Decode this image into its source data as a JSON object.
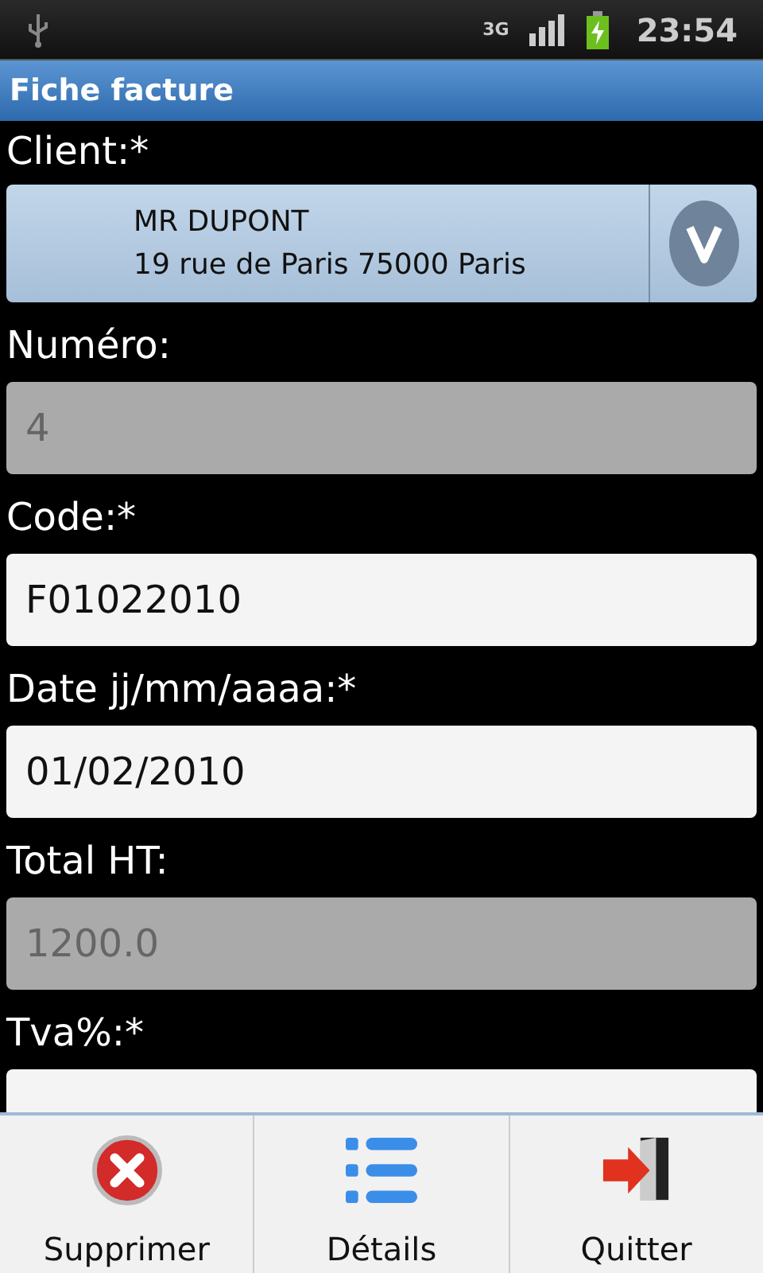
{
  "status_bar": {
    "time": "23:54",
    "network": "3G"
  },
  "title": "Fiche facture",
  "client": {
    "label": "Client:*",
    "name": "MR DUPONT",
    "address": "19 rue de Paris 75000 Paris"
  },
  "fields": [
    {
      "label": "Numéro:",
      "value": "4",
      "disabled": true
    },
    {
      "label": "Code:*",
      "value": "F01022010",
      "disabled": false
    },
    {
      "label": "Date jj/mm/aaaa:*",
      "value": "01/02/2010",
      "disabled": false
    },
    {
      "label": "Total HT:",
      "value": "1200.0",
      "disabled": true
    },
    {
      "label": "Tva%:*",
      "disabled": false
    }
  ],
  "menu": [
    {
      "label": "Supprimer",
      "kind": "delete"
    },
    {
      "label": "Détails",
      "kind": "list"
    },
    {
      "label": "Quitter",
      "kind": "exit"
    }
  ]
}
